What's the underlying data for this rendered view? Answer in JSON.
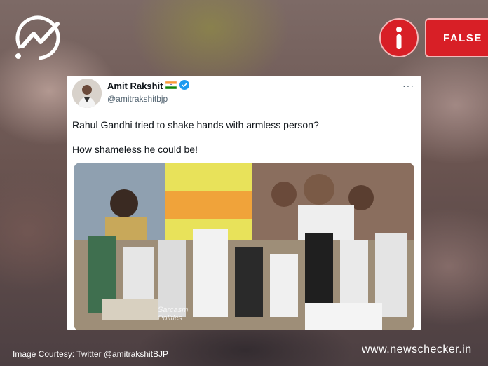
{
  "badge": {
    "verdict": "FALSE"
  },
  "tweet": {
    "author_name": "Amit Rakshit",
    "author_handle": "@amitrakshitbjp",
    "more_label": "···",
    "text_line1": "Rahul Gandhi tried to shake hands with armless person?",
    "text_line2": "How shameless he could be!",
    "media_watermark_line1": "Sarcasm",
    "media_watermark_line2": "Politics"
  },
  "footer": {
    "caption": "Image Courtesy: Twitter @amitrakshitBJP",
    "site": "www.newschecker.in"
  },
  "colors": {
    "accent_red": "#d81f26",
    "verified_blue": "#1d9bf0"
  },
  "icons": {
    "logo": "newschecker-check-logo-icon",
    "info": "info-icon",
    "verified": "verified-badge-icon",
    "flag": "india-flag-icon",
    "more": "more-dots-icon"
  }
}
